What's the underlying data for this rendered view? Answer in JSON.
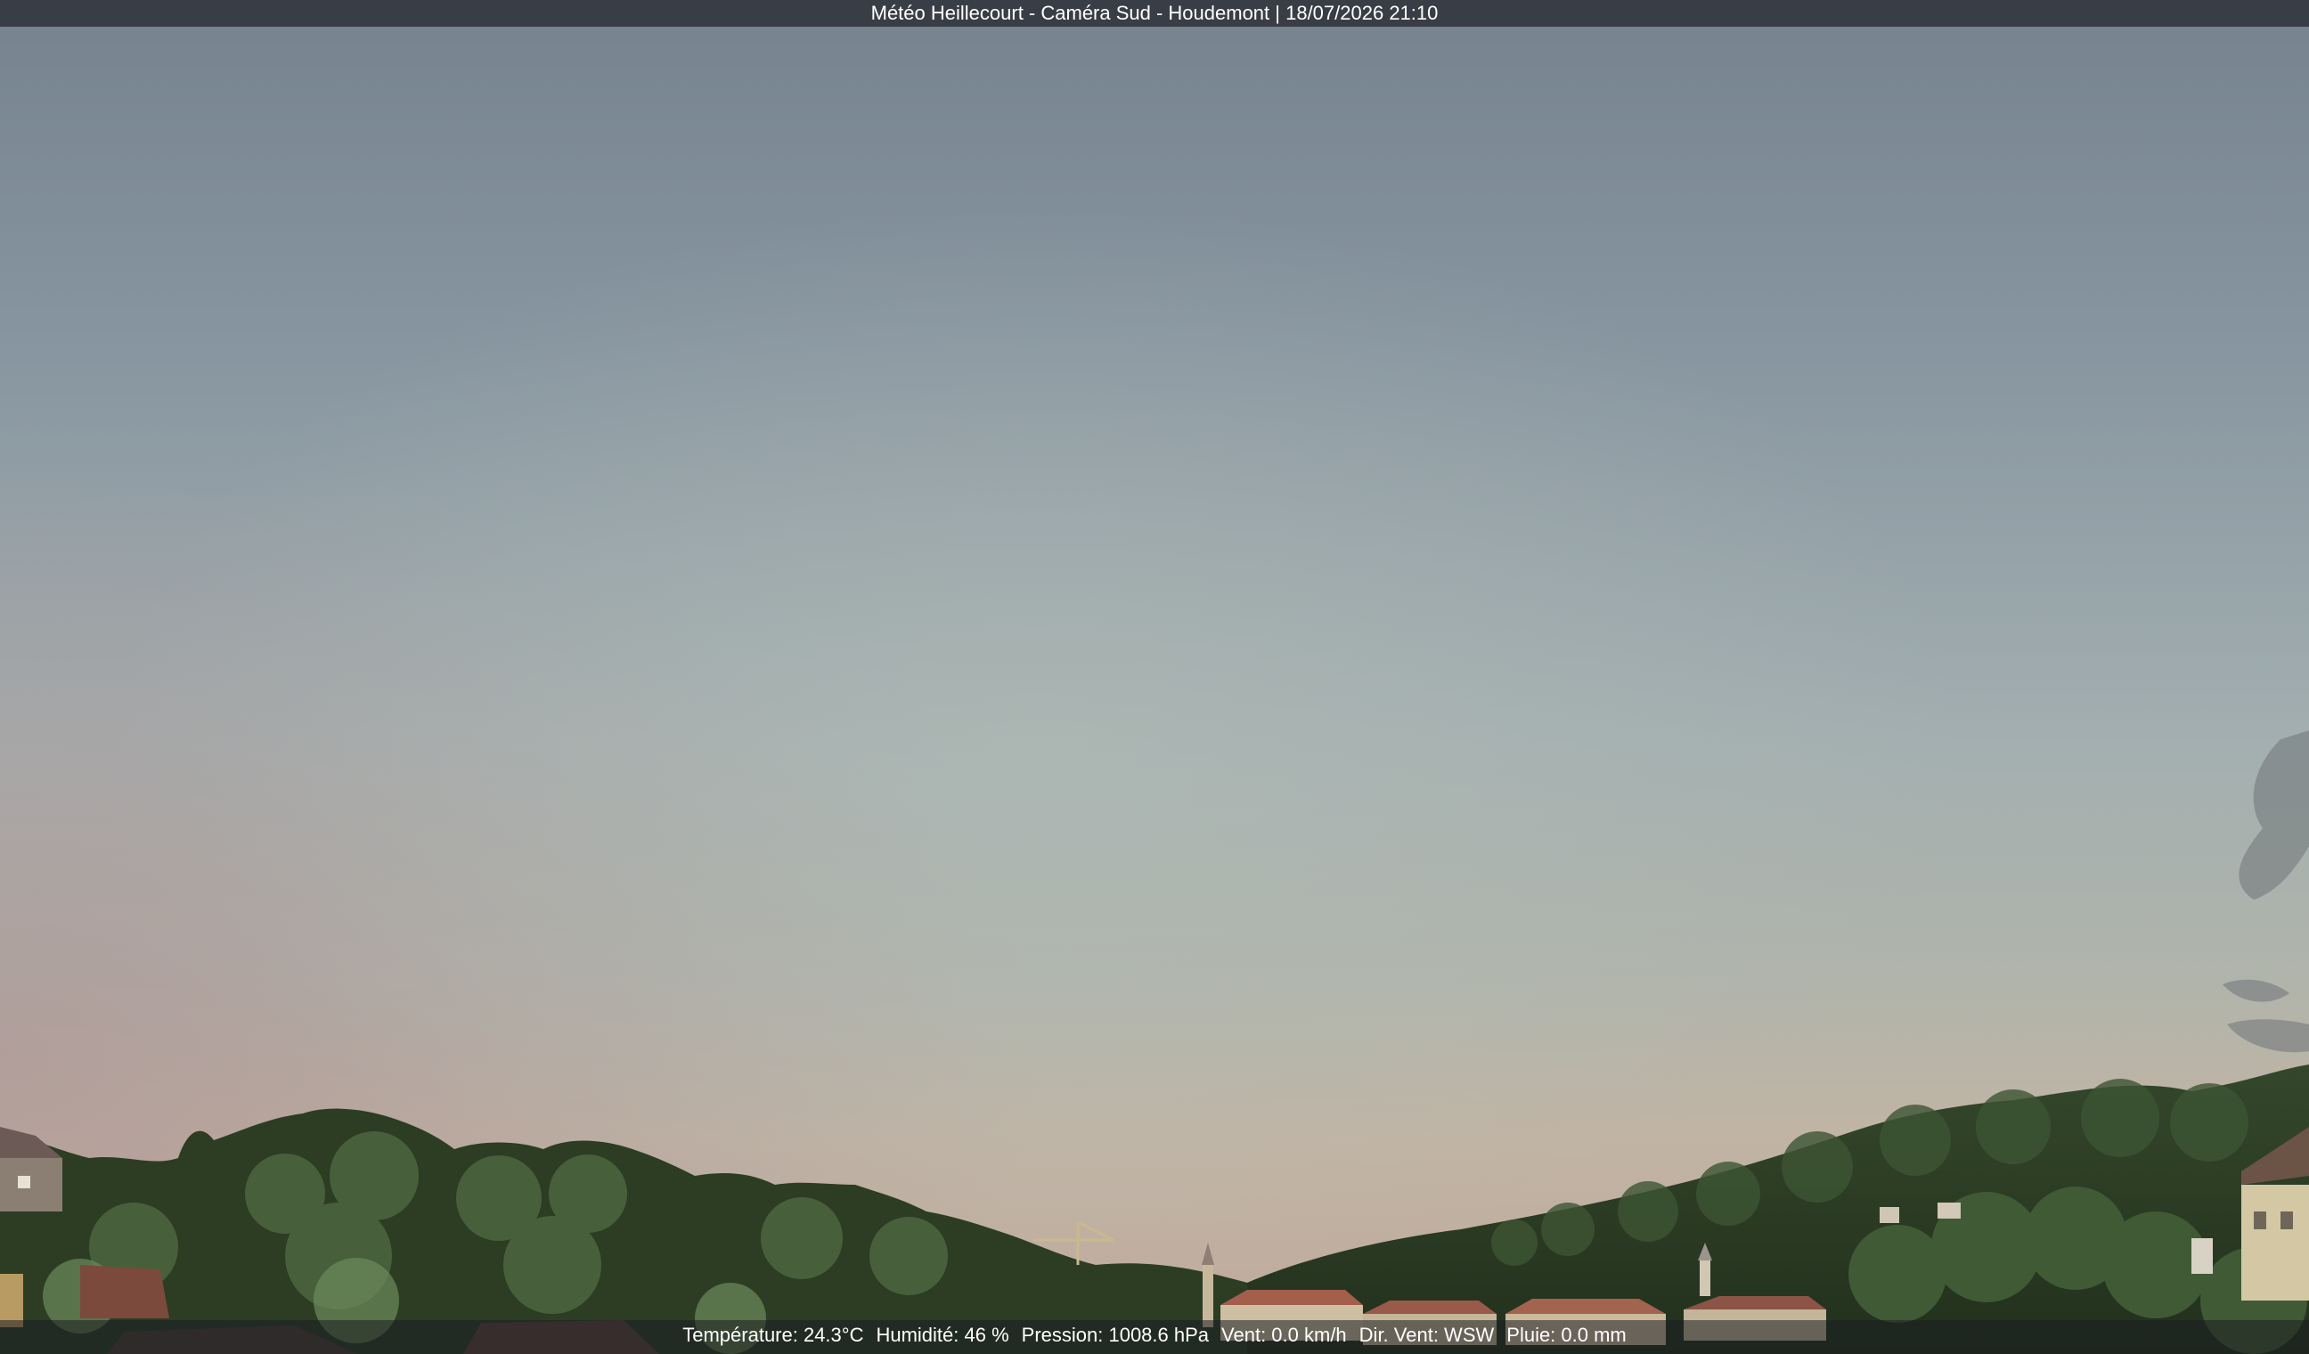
{
  "overlay": {
    "title": "Météo Heillecourt - Caméra Sud - Houdemont | 18/07/2026 21:10",
    "stats": [
      "Température: 24.3°C",
      "Humidité: 46 %",
      "Pression: 1008.6 hPa",
      "Vent: 0.0 km/h",
      "Dir. Vent: WSW",
      "Pluie: 0.0 mm"
    ]
  },
  "colors": {
    "sky_top": "#7c8a96",
    "sky_mid": "#a6b2b2",
    "sky_horizon": "#c3b2a2",
    "sky_horizon_pink": "#b39f96",
    "trees_dark": "#27371f",
    "trees_mid": "#3f5733",
    "trees_light": "#5c7a4f",
    "roof_red": "#a45e4c",
    "wall_beige": "#cdbfa2"
  }
}
